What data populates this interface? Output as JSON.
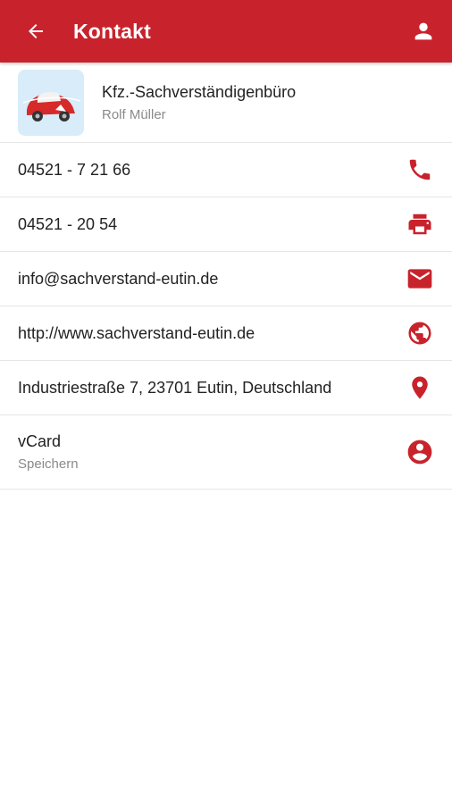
{
  "appbar": {
    "title": "Kontakt",
    "back_icon": "arrow-left-icon",
    "profile_icon": "person-icon",
    "color": "#c8232c"
  },
  "company": {
    "name": "Kfz.-Sachverständigenbüro",
    "person": "Rolf Müller",
    "logo_icon": "red-car-logo"
  },
  "contacts": [
    {
      "label": "04521 - 7 21 66",
      "icon": "phone-icon"
    },
    {
      "label": "04521 - 20 54",
      "icon": "printer-icon"
    },
    {
      "label": "info@sachverstand-eutin.de",
      "icon": "mail-icon"
    },
    {
      "label": "http://www.sachverstand-eutin.de",
      "icon": "globe-icon"
    },
    {
      "label": "Industriestraße 7, 23701 Eutin, Deutschland",
      "icon": "location-pin-icon"
    }
  ],
  "vcard": {
    "label": "vCard",
    "sub": "Speichern",
    "icon": "account-circle-icon"
  },
  "accent_color": "#c8232c"
}
